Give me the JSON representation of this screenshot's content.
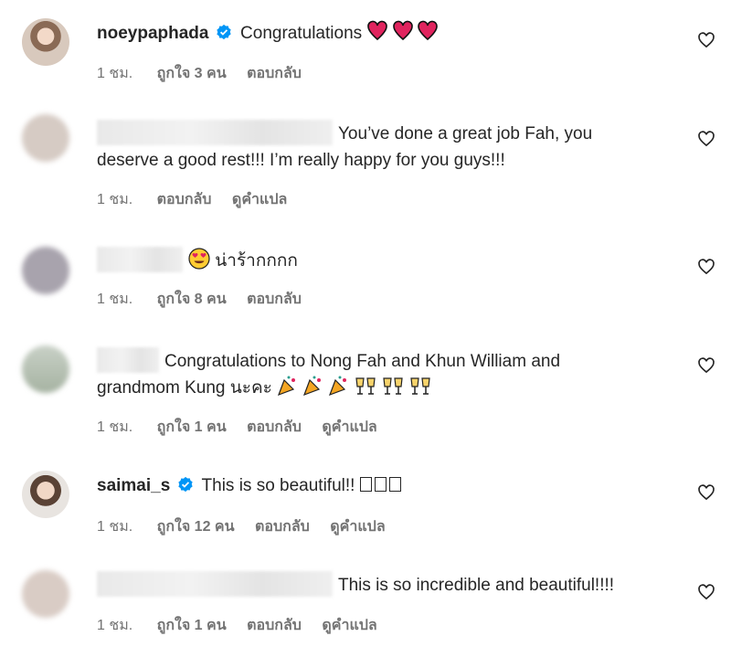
{
  "comments": [
    {
      "username": "noeypaphada",
      "text": "Congratulations",
      "time": "1 ชม.",
      "likes": "ถูกใจ 3 คน",
      "reply": "ตอบกลับ"
    },
    {
      "text": "You’ve done a great job Fah, you",
      "text2": "deserve a good rest!!! I’m really happy for you guys!!!",
      "time": "1 ชม.",
      "reply": "ตอบกลับ",
      "translate": "ดูคำแปล"
    },
    {
      "text": "น่าร้ากกกก",
      "time": "1 ชม.",
      "likes": "ถูกใจ 8 คน",
      "reply": "ตอบกลับ"
    },
    {
      "text": "Congratulations to Nong Fah and Khun William and",
      "text2": "grandmom Kung นะคะ",
      "time": "1 ชม.",
      "likes": "ถูกใจ 1 คน",
      "reply": "ตอบกลับ",
      "translate": "ดูคำแปล"
    },
    {
      "username": "saimai_s",
      "text": "This is so beautiful!!",
      "time": "1 ชม.",
      "likes": "ถูกใจ 12 คน",
      "reply": "ตอบกลับ",
      "translate": "ดูคำแปล"
    },
    {
      "text": "This is so incredible and beautiful!!!!",
      "time": "1 ชม.",
      "likes": "ถูกใจ 1 คน",
      "reply": "ตอบกลับ",
      "translate": "ดูคำแปล"
    }
  ],
  "icons": {
    "like": "heart-outline-icon",
    "verified": "verified-badge-icon"
  },
  "colors": {
    "verified": "#0095f6",
    "meta": "#737373",
    "text": "#262626",
    "heart_emoji": "#e0245e"
  }
}
